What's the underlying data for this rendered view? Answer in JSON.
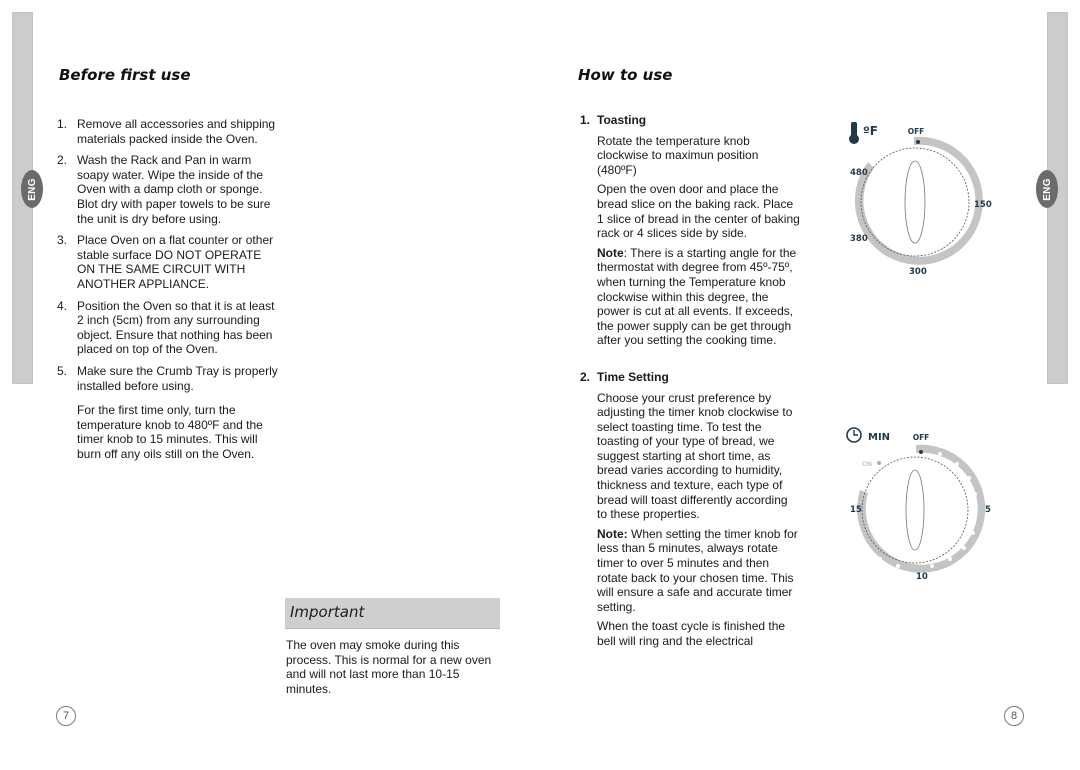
{
  "sidebar": {
    "language_label": "ENG"
  },
  "left_page": {
    "title": "Before first use",
    "steps": [
      {
        "num": "1.",
        "text": "Remove all accessories and shipping materials packed inside the Oven."
      },
      {
        "num": "2.",
        "text": "Wash the Rack and Pan in warm soapy water. Wipe the inside of the Oven with a damp cloth or sponge. Blot dry with paper towels to be sure the unit is dry before using."
      },
      {
        "num": "3.",
        "text": "Place Oven on a flat counter or other stable surface DO NOT OPERATE ON THE SAME CIRCUIT WITH ANOTHER APPLIANCE."
      },
      {
        "num": "4.",
        "text": "Position the Oven so that it is at least 2 inch (5cm) from any surrounding object. Ensure that nothing has been placed on top of the Oven."
      },
      {
        "num": "5.",
        "text": "Make sure the Crumb Tray is properly installed before using."
      }
    ],
    "first_time_note": "For the first time only, turn the temperature knob to 480ºF and the timer knob to 15 minutes. This will burn off any oils still on the Oven.",
    "important": {
      "label": "Important",
      "text": "The oven may smoke during this process. This is normal for a new oven and will not last more than 10-15 minutes."
    },
    "page_number": "7"
  },
  "right_page": {
    "title": "How to use",
    "sections": [
      {
        "num": "1.",
        "heading": "Toasting",
        "paragraphs": [
          "Rotate the temperature knob clockwise to maximun position (480ºF)",
          "Open the oven door and place the bread slice on the baking rack. Place 1 slice of bread in the center of baking rack or 4 slices side by side."
        ],
        "note_label": "Note",
        "note_text": ": There is a starting angle for the thermostat with degree from 45º-75º, when turning the Temperature knob clockwise within this degree, the power is cut at all events. If exceeds, the power supply can be get through after you setting the cooking time."
      },
      {
        "num": "2.",
        "heading": "Time Setting",
        "paragraphs": [
          "Choose your crust preference by adjusting the timer knob clockwise to select toasting time. To test the toasting of your type of bread, we suggest starting at short time, as bread varies according to humidity, thickness and texture, each type of bread will toast differently according to these properties."
        ],
        "note_label": "Note:",
        "note_text": " When setting the timer knob for less than 5 minutes, always rotate timer to over 5 minutes and then rotate back to your chosen time. This will ensure a safe and accurate timer setting.",
        "trailing": "When the toast cycle is finished the bell will ring and the electrical"
      }
    ],
    "temperature_dial": {
      "unit_label": "ºF",
      "icon": "thermometer-icon",
      "labels": {
        "off": "OFF",
        "t150": "150",
        "t300": "300",
        "t380": "380",
        "t480": "480"
      }
    },
    "timer_dial": {
      "unit_label": "MIN",
      "icon": "clock-icon",
      "labels": {
        "off": "OFF",
        "on": "ON",
        "m5": "5",
        "m10": "10",
        "m15": "15"
      }
    },
    "page_number": "8"
  },
  "colors": {
    "sidebar_gray": "#cccccc",
    "eng_tab": "#6b6b6b",
    "dial_band": "#c4c4c4",
    "dial_text": "#1f3a4d",
    "important_bg": "#cfcfcf"
  }
}
